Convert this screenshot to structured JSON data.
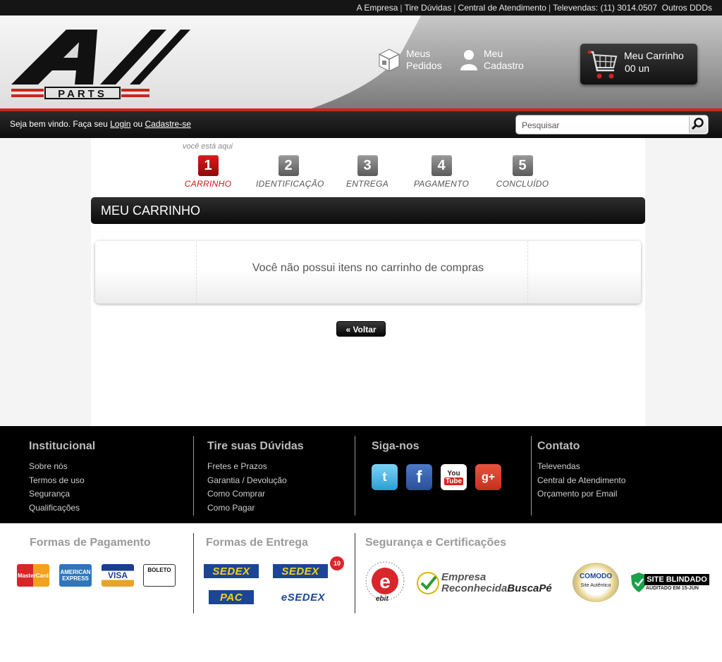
{
  "top_links": {
    "items": [
      "A Empresa",
      "Tire Dúvidas",
      "Central de Atendimento",
      "Televendas: (11) 3014.0507"
    ],
    "other": "Outros DDDs"
  },
  "header": {
    "logo_text": "PARTS",
    "orders_l1": "Meus",
    "orders_l2": "Pedidos",
    "account_l1": "Meu",
    "account_l2": "Cadastro",
    "cart_title": "Meu Carrinho",
    "cart_count": "00 un"
  },
  "welcome": {
    "text": "Seja bem vindo. Faça seu",
    "login": "Login",
    "or": "ou",
    "register": "Cadastre-se",
    "search_placeholder": "Pesquisar"
  },
  "checkout": {
    "here": "você está aqui",
    "steps": [
      {
        "num": "1",
        "label": "CARRINHO"
      },
      {
        "num": "2",
        "label": "IDENTIFICAÇÃO"
      },
      {
        "num": "3",
        "label": "ENTREGA"
      },
      {
        "num": "4",
        "label": "PAGAMENTO"
      },
      {
        "num": "5",
        "label": "CONCLUÍDO"
      }
    ],
    "title": "MEU CARRINHO",
    "empty_msg": "Você não possui itens no carrinho de compras",
    "back": "« Voltar"
  },
  "footer": {
    "institucional": {
      "title": "Institucional",
      "items": [
        "Sobre nós",
        "Termos de uso",
        "Segurança",
        "Qualificações"
      ]
    },
    "duvidas": {
      "title": "Tire suas Dúvidas",
      "items": [
        "Fretes e Prazos",
        "Garantia / Devolução",
        "Como Comprar",
        "Como Pagar"
      ]
    },
    "siga": {
      "title": "Siga-nos"
    },
    "contato": {
      "title": "Contato",
      "items": [
        "Televendas",
        "Central de Atendimento",
        "Orçamento por Email"
      ]
    },
    "pagamento": {
      "title": "Formas de Pagamento",
      "cards": [
        "MasterCard",
        "AMERICAN EXPRESS",
        "VISA",
        "BOLETO"
      ]
    },
    "entrega": {
      "title": "Formas de Entrega",
      "methods": [
        "SEDEX",
        "SEDEX",
        "PAC",
        "eSEDEX"
      ],
      "badge": "10"
    },
    "seguranca": {
      "title": "Segurança e Certificações",
      "ebit": "ebit",
      "buscape_l1": "Empresa",
      "buscape_l2": "Reconhecida",
      "buscape_brand": "BuscaPé",
      "comodo": "COMODO",
      "comodo_sub": "Site Autêntico",
      "blindado": "SITE BLINDADO",
      "blindado_sub": "AUDITADO EM 15-JUN"
    }
  }
}
